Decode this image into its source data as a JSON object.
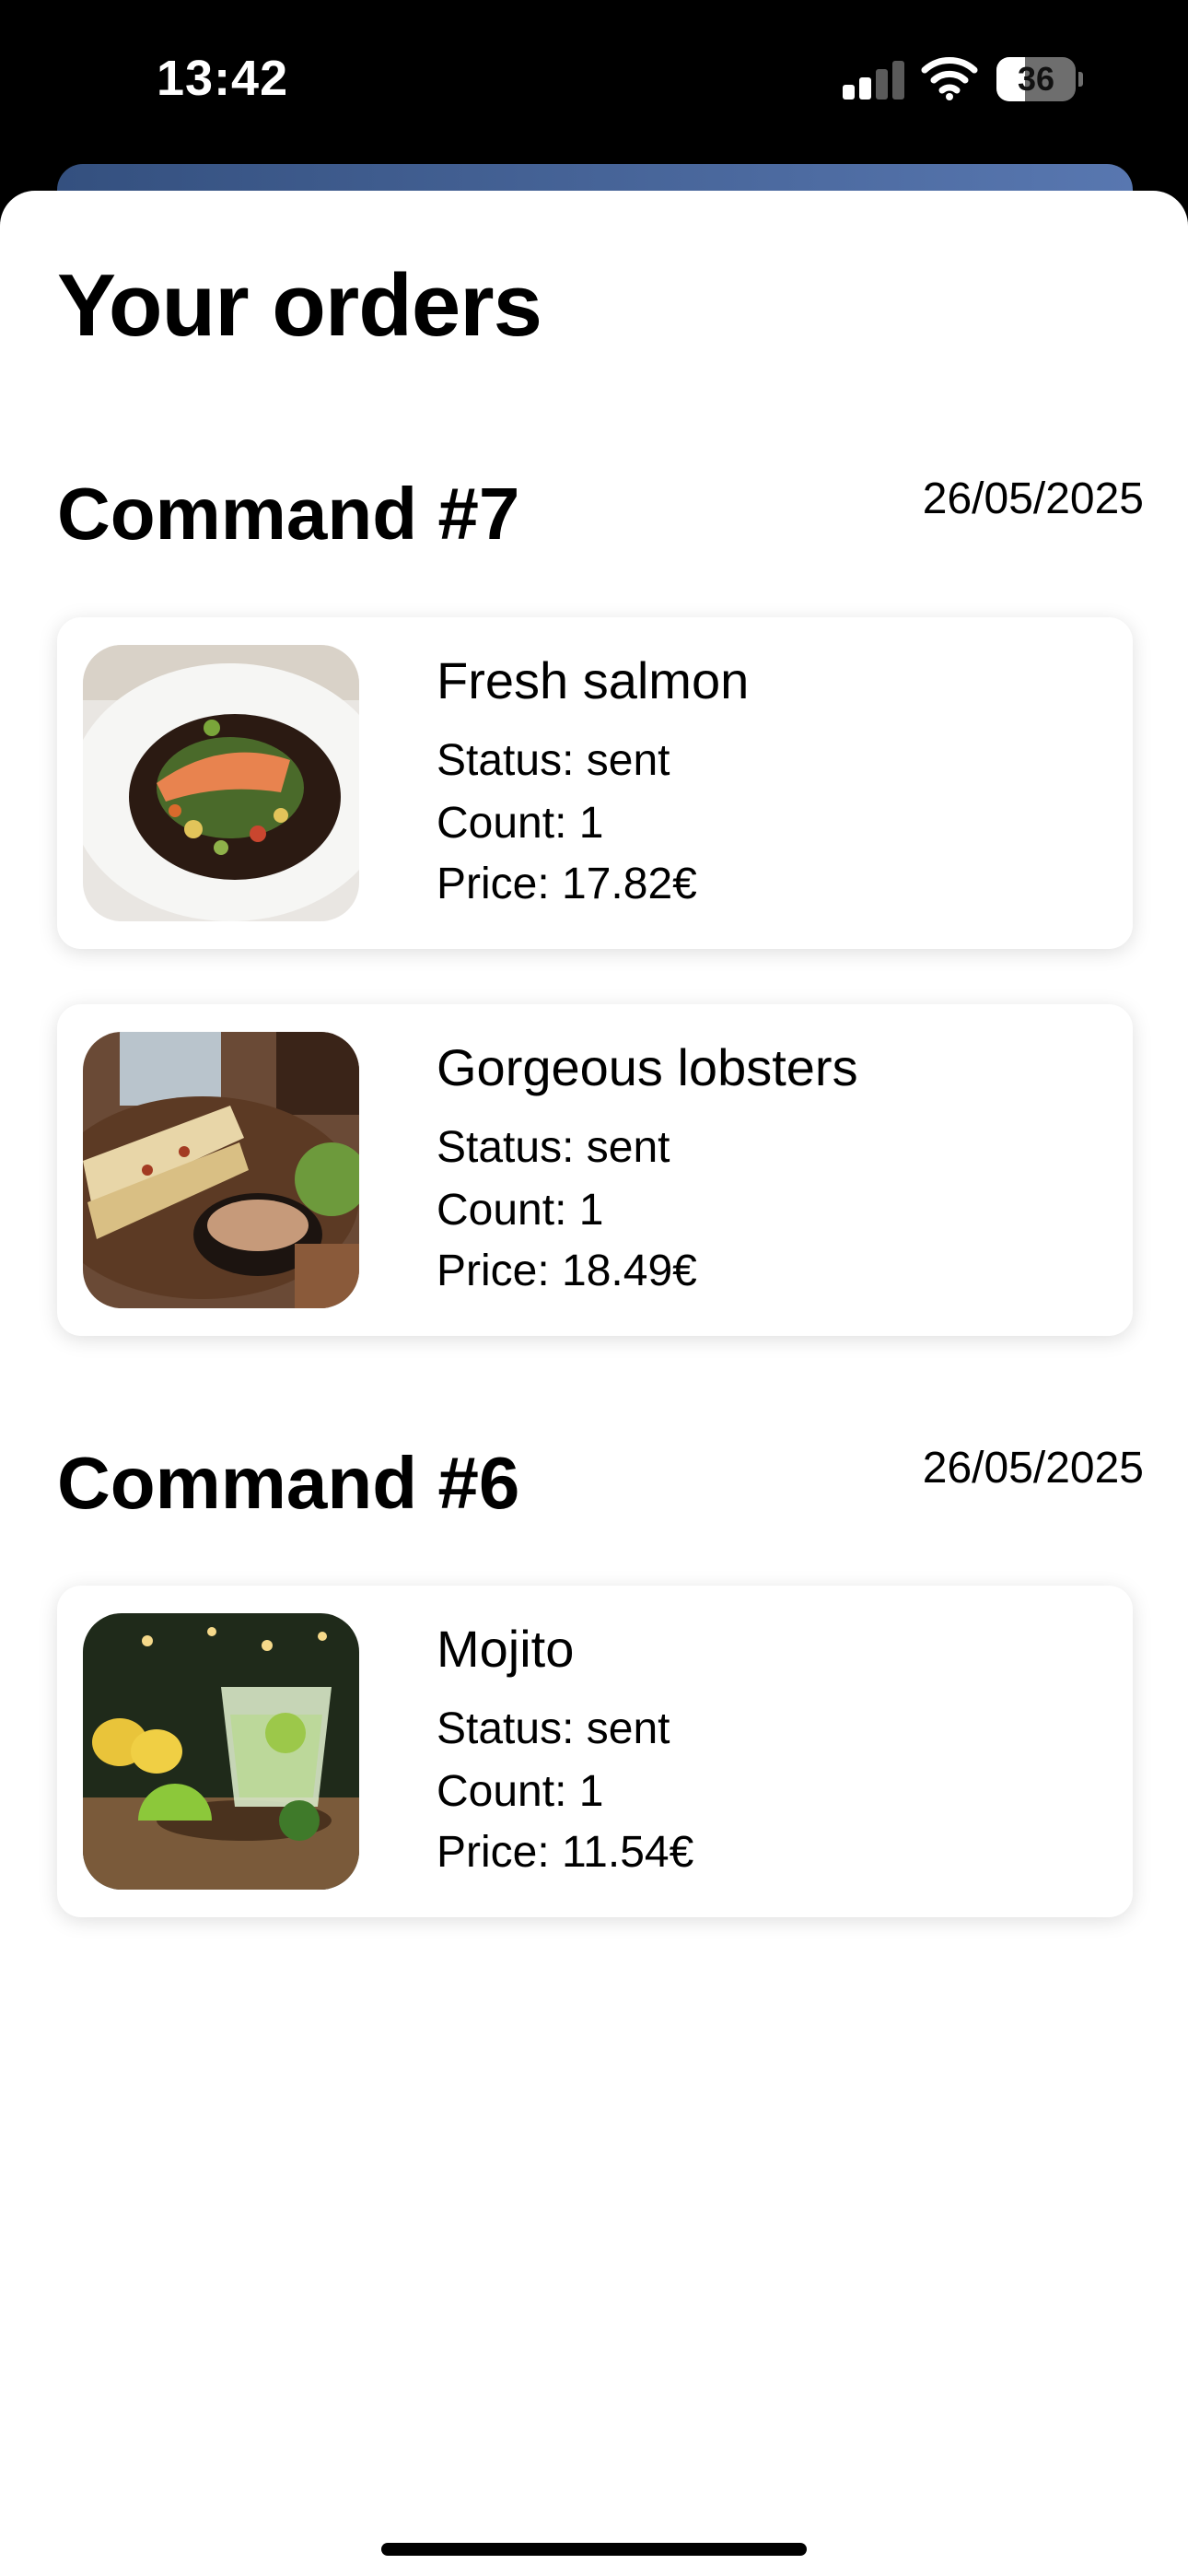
{
  "status_bar": {
    "time": "13:42",
    "battery_level": 36,
    "battery_text": "36"
  },
  "page": {
    "title": "Your orders"
  },
  "commands": [
    {
      "title": "Command #7",
      "date": "26/05/2025",
      "items": [
        {
          "name": "Fresh salmon",
          "status": "Status: sent",
          "count": "Count: 1",
          "price": "Price: 17.82€",
          "image": "salmon-dish-photo"
        },
        {
          "name": "Gorgeous lobsters",
          "status": "Status: sent",
          "count": "Count: 1",
          "price": "Price: 18.49€",
          "image": "lobster-dish-photo"
        }
      ]
    },
    {
      "title": "Command #6",
      "date": "26/05/2025",
      "items": [
        {
          "name": "Mojito",
          "status": "Status: sent",
          "count": "Count: 1",
          "price": "Price: 11.54€",
          "image": "mojito-drink-photo"
        }
      ]
    }
  ],
  "icons": [
    "signal-icon",
    "wifi-icon",
    "battery-icon"
  ],
  "colors": {
    "background": "#ffffff",
    "status_bar": "#000000",
    "back_sheet_accent": "#4a6aa3",
    "text": "#000000"
  }
}
